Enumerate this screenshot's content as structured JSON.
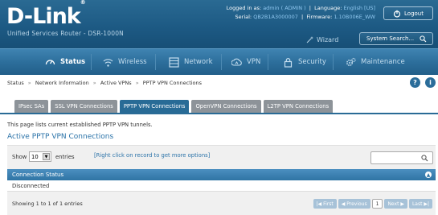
{
  "header": {
    "logo": "D-Link",
    "subtitle": "Unified Services Router - DSR-1000N",
    "logged_in_label": "Logged in as:",
    "logged_in_value": "admin ( ADMIN )",
    "language_label": "Language:",
    "language_value": "English [US]",
    "serial_label": "Serial:",
    "serial_value": "QB2B1A3000007",
    "firmware_label": "Firmware:",
    "firmware_value": "1.10B006E_WW",
    "logout_label": "Logout",
    "wizard_label": "Wizard",
    "search_label": "System Search..."
  },
  "nav": {
    "items": [
      {
        "label": "Status",
        "icon": "gauge-icon",
        "active": true
      },
      {
        "label": "Wireless",
        "icon": "wifi-icon",
        "active": false
      },
      {
        "label": "Network",
        "icon": "network-icon",
        "active": false
      },
      {
        "label": "VPN",
        "icon": "vpn-cloud-icon",
        "active": false
      },
      {
        "label": "Security",
        "icon": "lock-icon",
        "active": false
      },
      {
        "label": "Maintenance",
        "icon": "gears-icon",
        "active": false
      }
    ]
  },
  "breadcrumb": {
    "items": [
      "Status",
      "Network Information",
      "Active VPNs",
      "PPTP VPN Connections"
    ],
    "separator": "»"
  },
  "tabs": [
    {
      "label": "IPsec SAs",
      "active": false
    },
    {
      "label": "SSL VPN Connections",
      "active": false
    },
    {
      "label": "PPTP VPN Connections",
      "active": true
    },
    {
      "label": "OpenVPN Connections",
      "active": false
    },
    {
      "label": "L2TP VPN Connections",
      "active": false
    }
  ],
  "page": {
    "description": "This page lists current established PPTP VPN tunnels.",
    "section_title": "Active PPTP VPN Connections"
  },
  "table": {
    "show_label": "Show",
    "entries_value": "10",
    "entries_label": "entries",
    "hint": "[Right click on record to get more options]",
    "column_header": "Connection Status",
    "rows": [
      "Disconnected"
    ],
    "showing_text": "Showing 1 to 1 of 1 entries",
    "pager": {
      "first": "First",
      "previous": "Previous",
      "current": "1",
      "next": "Next",
      "last": "Last"
    }
  },
  "colors": {
    "header_bg": "#1d5a84",
    "nav_bg": "#2d6f9c",
    "accent": "#2a72a8",
    "tab_active": "#286b96",
    "tab_inactive": "#8d9399"
  }
}
